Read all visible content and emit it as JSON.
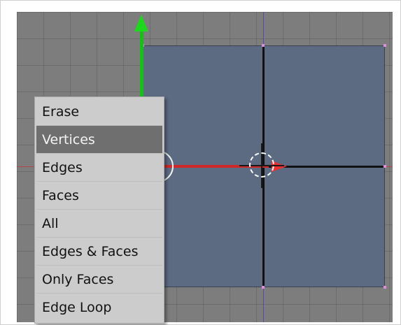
{
  "popup_menu": {
    "items": [
      {
        "label": "Erase",
        "highlighted": false
      },
      {
        "label": "Vertices",
        "highlighted": true
      },
      {
        "label": "Edges",
        "highlighted": false
      },
      {
        "label": "Faces",
        "highlighted": false
      },
      {
        "label": "All",
        "highlighted": false
      },
      {
        "label": "Edges & Faces",
        "highlighted": false
      },
      {
        "label": "Only Faces",
        "highlighted": false
      },
      {
        "label": "Edge Loop",
        "highlighted": false
      }
    ]
  },
  "colors": {
    "viewport_bg": "#7d7d7d",
    "mesh_face": "#5c6a82",
    "menu_bg": "#cccccc",
    "menu_highlight": "#6f6f6f",
    "gizmo_y": "#16c016",
    "gizmo_x": "#d02828",
    "vertex": "#d890d8"
  }
}
